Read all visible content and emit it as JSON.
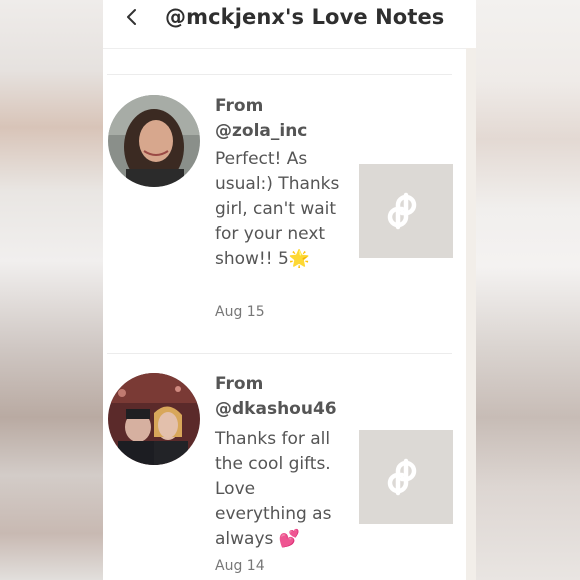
{
  "header": {
    "back_icon": "chevron-left-icon",
    "title": "@mckjenx's Love Notes"
  },
  "notes": [
    {
      "from_label": "From",
      "handle": "@zola_inc",
      "message": "Perfect! As usual:) Thanks girl, can't wait for your next show!! 5🌟",
      "date": "Aug 15",
      "listing_icon": "poshmark-p-icon"
    },
    {
      "from_label": "From",
      "handle": "@dkashou46",
      "message": "Thanks for all the cool gifts. Love everything as always 💕",
      "date": "Aug 14",
      "listing_icon": "poshmark-p-icon"
    }
  ],
  "colors": {
    "text": "#555555",
    "title": "#2f2f2f",
    "thumb_bg": "#dcd9d5"
  }
}
